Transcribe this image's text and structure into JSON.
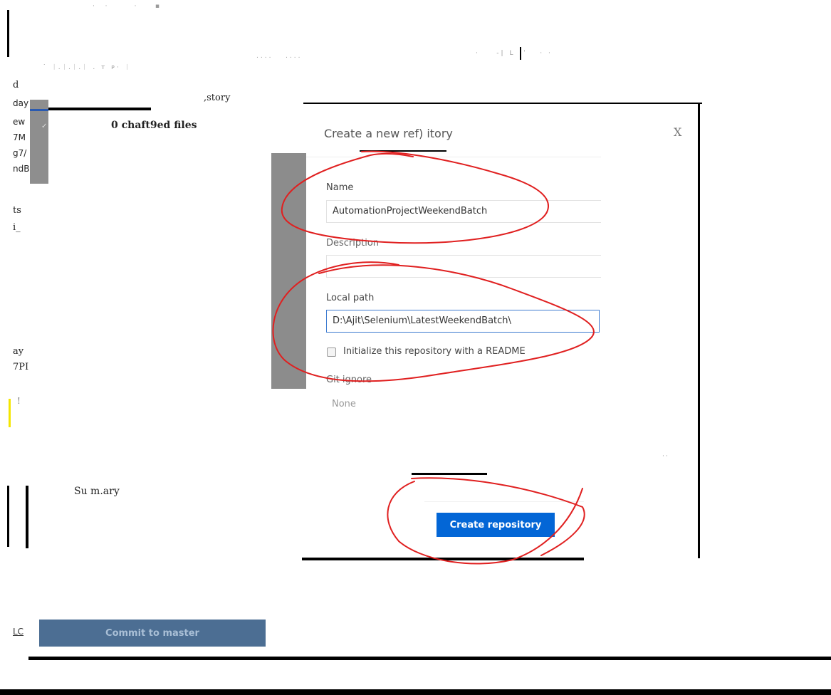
{
  "left_panel": {
    "fragments": [
      "d",
      "day",
      "ew",
      "7M",
      "g7/",
      "ndB",
      "ts",
      "i_",
      "ay",
      "7PI",
      "!"
    ],
    "history_suffix": ",story",
    "changed_files_label": "0 chaft9ed files",
    "summary_label": "Su m.ary",
    "commit_prefix": "LC",
    "commit_button_label": "Commit to master"
  },
  "dialog": {
    "title": "Create a new ref) itory",
    "close_glyph": "X",
    "name_label": "Name",
    "name_value": "AutomationProjectWeekendBatch",
    "description_label": "Description",
    "description_value": "",
    "local_path_label": "Local path",
    "local_path_value": "D:\\Ajit\\Selenium\\LatestWeekendBatch\\",
    "readme_label": "Initialize this repository with a README",
    "git_ignore_label": "Git ignore",
    "git_ignore_value": "None",
    "create_button_label": "Create repository"
  },
  "annotation_color": "#e02020"
}
